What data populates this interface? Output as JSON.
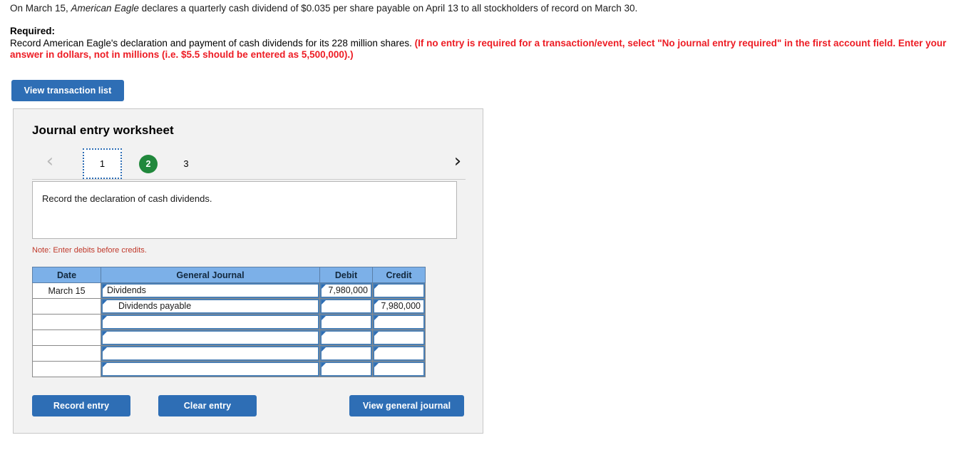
{
  "problem": {
    "statement_pre": "On March 15, ",
    "statement_company": "American Eagle",
    "statement_post": " declares a quarterly cash dividend of $0.035 per share payable on April 13 to all stockholders of record on March 30.",
    "required_label": "Required:",
    "required_body": "Record American Eagle's declaration and payment of cash dividends for its 228 million shares. ",
    "required_note": "(If no entry is required for a transaction/event, select \"No journal entry required\" in the first account field. Enter your answer in dollars, not in millions (i.e. $5.5 should be entered as 5,500,000).)"
  },
  "toolbar": {
    "view_transaction_list_label": "View transaction list"
  },
  "worksheet": {
    "title": "Journal entry worksheet",
    "prev_arrow": "‹",
    "next_arrow": "›",
    "tabs": [
      {
        "label": "1",
        "state": "current"
      },
      {
        "label": "2",
        "state": "completed"
      },
      {
        "label": "3",
        "state": "pending"
      }
    ],
    "instruction": "Record the declaration of cash dividends.",
    "note": "Note: Enter debits before credits.",
    "columns": [
      "Date",
      "General Journal",
      "Debit",
      "Credit"
    ],
    "rows": [
      {
        "date": "March 15",
        "account": "Dividends",
        "indent": false,
        "debit": "7,980,000",
        "credit": ""
      },
      {
        "date": "",
        "account": "Dividends payable",
        "indent": true,
        "debit": "",
        "credit": "7,980,000"
      },
      {
        "date": "",
        "account": "",
        "indent": false,
        "debit": "",
        "credit": ""
      },
      {
        "date": "",
        "account": "",
        "indent": false,
        "debit": "",
        "credit": ""
      },
      {
        "date": "",
        "account": "",
        "indent": false,
        "debit": "",
        "credit": ""
      },
      {
        "date": "",
        "account": "",
        "indent": false,
        "debit": "",
        "credit": ""
      }
    ],
    "actions": {
      "record_entry_label": "Record entry",
      "clear_entry_label": "Clear entry",
      "view_general_journal_label": "View general journal"
    }
  },
  "colors": {
    "button_blue": "#2e6eb5",
    "header_blue": "#7cb0e8",
    "tab_green": "#21883c",
    "alert_red": "#ed1c24",
    "note_red": "#c0392b",
    "panel_gray": "#f2f2f2"
  }
}
